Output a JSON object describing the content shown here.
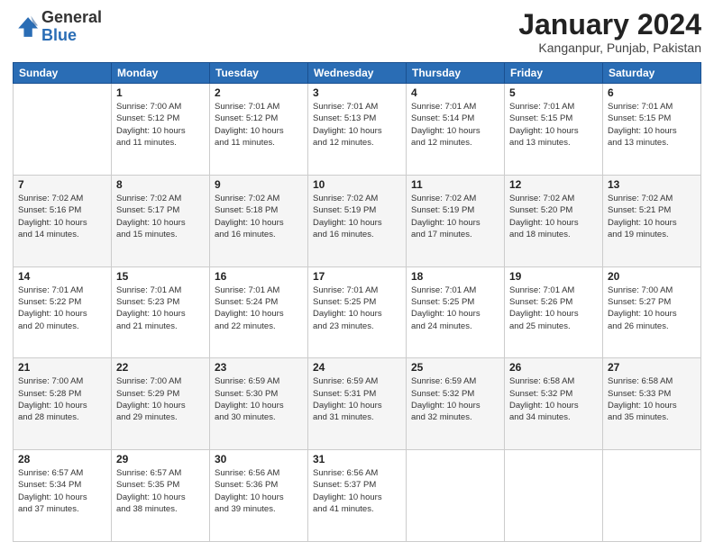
{
  "header": {
    "logo": {
      "line1": "General",
      "line2": "Blue"
    },
    "title": "January 2024",
    "subtitle": "Kanganpur, Punjab, Pakistan"
  },
  "columns": [
    "Sunday",
    "Monday",
    "Tuesday",
    "Wednesday",
    "Thursday",
    "Friday",
    "Saturday"
  ],
  "weeks": [
    {
      "shaded": false,
      "days": [
        {
          "num": "",
          "info": ""
        },
        {
          "num": "1",
          "info": "Sunrise: 7:00 AM\nSunset: 5:12 PM\nDaylight: 10 hours\nand 11 minutes."
        },
        {
          "num": "2",
          "info": "Sunrise: 7:01 AM\nSunset: 5:12 PM\nDaylight: 10 hours\nand 11 minutes."
        },
        {
          "num": "3",
          "info": "Sunrise: 7:01 AM\nSunset: 5:13 PM\nDaylight: 10 hours\nand 12 minutes."
        },
        {
          "num": "4",
          "info": "Sunrise: 7:01 AM\nSunset: 5:14 PM\nDaylight: 10 hours\nand 12 minutes."
        },
        {
          "num": "5",
          "info": "Sunrise: 7:01 AM\nSunset: 5:15 PM\nDaylight: 10 hours\nand 13 minutes."
        },
        {
          "num": "6",
          "info": "Sunrise: 7:01 AM\nSunset: 5:15 PM\nDaylight: 10 hours\nand 13 minutes."
        }
      ]
    },
    {
      "shaded": true,
      "days": [
        {
          "num": "7",
          "info": "Sunrise: 7:02 AM\nSunset: 5:16 PM\nDaylight: 10 hours\nand 14 minutes."
        },
        {
          "num": "8",
          "info": "Sunrise: 7:02 AM\nSunset: 5:17 PM\nDaylight: 10 hours\nand 15 minutes."
        },
        {
          "num": "9",
          "info": "Sunrise: 7:02 AM\nSunset: 5:18 PM\nDaylight: 10 hours\nand 16 minutes."
        },
        {
          "num": "10",
          "info": "Sunrise: 7:02 AM\nSunset: 5:19 PM\nDaylight: 10 hours\nand 16 minutes."
        },
        {
          "num": "11",
          "info": "Sunrise: 7:02 AM\nSunset: 5:19 PM\nDaylight: 10 hours\nand 17 minutes."
        },
        {
          "num": "12",
          "info": "Sunrise: 7:02 AM\nSunset: 5:20 PM\nDaylight: 10 hours\nand 18 minutes."
        },
        {
          "num": "13",
          "info": "Sunrise: 7:02 AM\nSunset: 5:21 PM\nDaylight: 10 hours\nand 19 minutes."
        }
      ]
    },
    {
      "shaded": false,
      "days": [
        {
          "num": "14",
          "info": "Sunrise: 7:01 AM\nSunset: 5:22 PM\nDaylight: 10 hours\nand 20 minutes."
        },
        {
          "num": "15",
          "info": "Sunrise: 7:01 AM\nSunset: 5:23 PM\nDaylight: 10 hours\nand 21 minutes."
        },
        {
          "num": "16",
          "info": "Sunrise: 7:01 AM\nSunset: 5:24 PM\nDaylight: 10 hours\nand 22 minutes."
        },
        {
          "num": "17",
          "info": "Sunrise: 7:01 AM\nSunset: 5:25 PM\nDaylight: 10 hours\nand 23 minutes."
        },
        {
          "num": "18",
          "info": "Sunrise: 7:01 AM\nSunset: 5:25 PM\nDaylight: 10 hours\nand 24 minutes."
        },
        {
          "num": "19",
          "info": "Sunrise: 7:01 AM\nSunset: 5:26 PM\nDaylight: 10 hours\nand 25 minutes."
        },
        {
          "num": "20",
          "info": "Sunrise: 7:00 AM\nSunset: 5:27 PM\nDaylight: 10 hours\nand 26 minutes."
        }
      ]
    },
    {
      "shaded": true,
      "days": [
        {
          "num": "21",
          "info": "Sunrise: 7:00 AM\nSunset: 5:28 PM\nDaylight: 10 hours\nand 28 minutes."
        },
        {
          "num": "22",
          "info": "Sunrise: 7:00 AM\nSunset: 5:29 PM\nDaylight: 10 hours\nand 29 minutes."
        },
        {
          "num": "23",
          "info": "Sunrise: 6:59 AM\nSunset: 5:30 PM\nDaylight: 10 hours\nand 30 minutes."
        },
        {
          "num": "24",
          "info": "Sunrise: 6:59 AM\nSunset: 5:31 PM\nDaylight: 10 hours\nand 31 minutes."
        },
        {
          "num": "25",
          "info": "Sunrise: 6:59 AM\nSunset: 5:32 PM\nDaylight: 10 hours\nand 32 minutes."
        },
        {
          "num": "26",
          "info": "Sunrise: 6:58 AM\nSunset: 5:32 PM\nDaylight: 10 hours\nand 34 minutes."
        },
        {
          "num": "27",
          "info": "Sunrise: 6:58 AM\nSunset: 5:33 PM\nDaylight: 10 hours\nand 35 minutes."
        }
      ]
    },
    {
      "shaded": false,
      "days": [
        {
          "num": "28",
          "info": "Sunrise: 6:57 AM\nSunset: 5:34 PM\nDaylight: 10 hours\nand 37 minutes."
        },
        {
          "num": "29",
          "info": "Sunrise: 6:57 AM\nSunset: 5:35 PM\nDaylight: 10 hours\nand 38 minutes."
        },
        {
          "num": "30",
          "info": "Sunrise: 6:56 AM\nSunset: 5:36 PM\nDaylight: 10 hours\nand 39 minutes."
        },
        {
          "num": "31",
          "info": "Sunrise: 6:56 AM\nSunset: 5:37 PM\nDaylight: 10 hours\nand 41 minutes."
        },
        {
          "num": "",
          "info": ""
        },
        {
          "num": "",
          "info": ""
        },
        {
          "num": "",
          "info": ""
        }
      ]
    }
  ]
}
